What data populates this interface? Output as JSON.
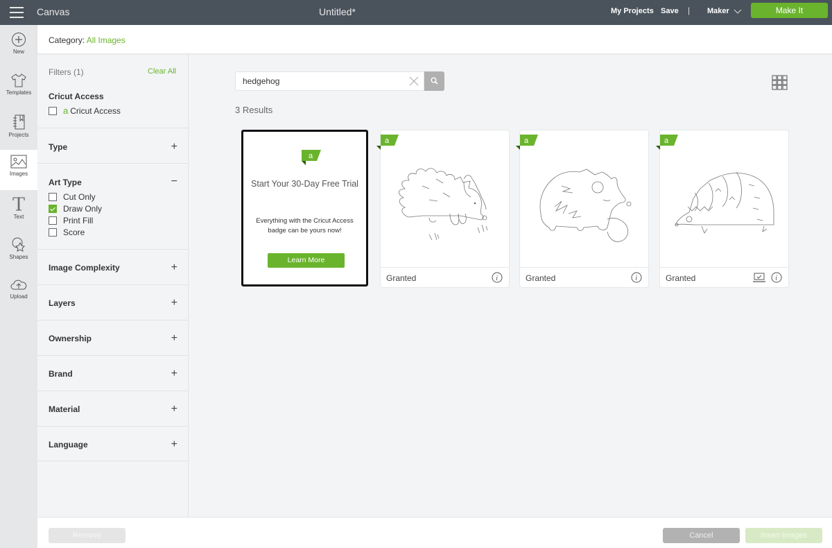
{
  "topbar": {
    "app_name": "Canvas",
    "doc_title": "Untitled*",
    "my_projects": "My Projects",
    "save": "Save",
    "separator": "|",
    "machine": "Maker",
    "make_it": "Make It"
  },
  "leftnav": {
    "items": [
      {
        "label": "New",
        "icon": "plus-circle-icon"
      },
      {
        "label": "Templates",
        "icon": "tshirt-icon"
      },
      {
        "label": "Projects",
        "icon": "notebook-icon"
      },
      {
        "label": "Images",
        "icon": "image-icon",
        "active": true
      },
      {
        "label": "Text",
        "icon": "text-t-icon"
      },
      {
        "label": "Shapes",
        "icon": "shapes-icon"
      },
      {
        "label": "Upload",
        "icon": "cloud-upload-icon"
      }
    ]
  },
  "category": {
    "label": "Category:",
    "value": "All Images"
  },
  "filters": {
    "title": "Filters (1)",
    "clear_all": "Clear All",
    "cricut_access": {
      "heading": "Cricut Access",
      "option": {
        "label": "Cricut Access",
        "checked": false
      }
    },
    "art_type": {
      "heading": "Art Type",
      "toggle": "−",
      "options": [
        {
          "label": "Cut Only",
          "checked": false
        },
        {
          "label": "Draw Only",
          "checked": true
        },
        {
          "label": "Print Fill",
          "checked": false
        },
        {
          "label": "Score",
          "checked": false
        }
      ]
    },
    "collapsed_sections": [
      {
        "label": "Type",
        "toggle": "+"
      },
      {
        "label": "Image Complexity",
        "toggle": "+"
      },
      {
        "label": "Layers",
        "toggle": "+"
      },
      {
        "label": "Ownership",
        "toggle": "+"
      },
      {
        "label": "Brand",
        "toggle": "+"
      },
      {
        "label": "Material",
        "toggle": "+"
      },
      {
        "label": "Language",
        "toggle": "+"
      }
    ]
  },
  "search": {
    "value": "hedgehog",
    "results_count": "3 Results"
  },
  "promo": {
    "badge": "a",
    "title": "Start Your 30-Day Free Trial",
    "text": "Everything with the Cricut Access badge can be yours now!",
    "button": "Learn More"
  },
  "images": [
    {
      "name": "hedgehog-walking",
      "badge": "a",
      "status": "Granted",
      "has_device_icon": false
    },
    {
      "name": "hedgehog-mother-baby",
      "badge": "a",
      "status": "Granted",
      "has_device_icon": false
    },
    {
      "name": "hedgehog-mandala",
      "badge": "a",
      "status": "Granted",
      "has_device_icon": true
    }
  ],
  "bottombar": {
    "remove": "Remove",
    "cancel": "Cancel",
    "insert": "Insert Images"
  },
  "colors": {
    "accent": "#6ab42d",
    "topbar": "#4a535c"
  }
}
